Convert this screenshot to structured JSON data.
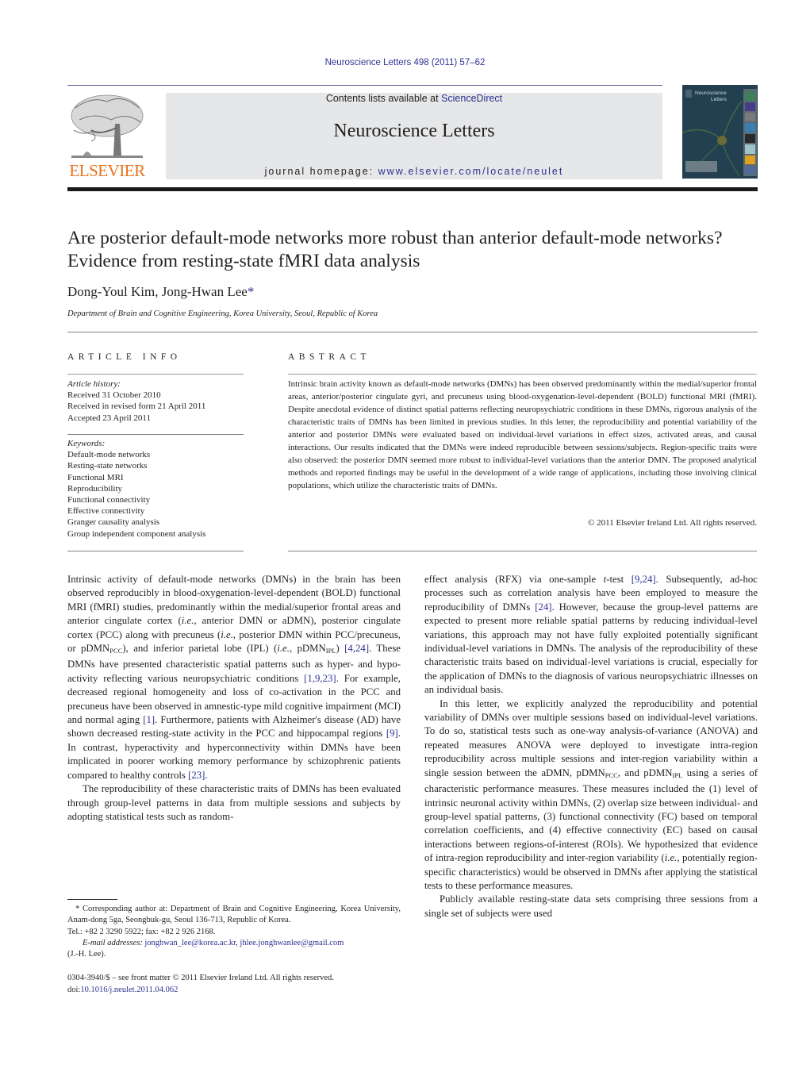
{
  "header": {
    "citation": "Neuroscience Letters 498 (2011) 57–62",
    "contents_prefix": "Contents lists available at ",
    "contents_link": "ScienceDirect",
    "journal_title": "Neuroscience Letters",
    "homepage_prefix": "journal homepage: ",
    "homepage_link": "www.elsevier.com/locate/neulet",
    "publisher_logo_text": "ELSEVIER",
    "cover": {
      "title_line1": "Neuroscience",
      "title_line2": "Letters"
    }
  },
  "colors": {
    "link": "#2e3192",
    "publisher_orange": "#e9711c",
    "banner_bg": "#e6e7e8",
    "text": "#231f20"
  },
  "article": {
    "title": "Are posterior default-mode networks more robust than anterior default-mode networks? Evidence from resting-state fMRI data analysis",
    "authors": "Dong-Youl Kim, Jong-Hwan Lee",
    "author_mark": "*",
    "affiliation": "Department of Brain and Cognitive Engineering, Korea University, Seoul, Republic of Korea"
  },
  "article_info": {
    "heading": "ARTICLE INFO",
    "history_label": "Article history:",
    "history": [
      "Received 31 October 2010",
      "Received in revised form 21 April 2011",
      "Accepted 23 April 2011"
    ],
    "keywords_label": "Keywords:",
    "keywords": [
      "Default-mode networks",
      "Resting-state networks",
      "Functional MRI",
      "Reproducibility",
      "Functional connectivity",
      "Effective connectivity",
      "Granger causality analysis",
      "Group independent component analysis"
    ]
  },
  "abstract": {
    "heading": "ABSTRACT",
    "text": "Intrinsic brain activity known as default-mode networks (DMNs) has been observed predominantly within the medial/superior frontal areas, anterior/posterior cingulate gyri, and precuneus using blood-oxygenation-level-dependent (BOLD) functional MRI (fMRI). Despite anecdotal evidence of distinct spatial patterns reflecting neuropsychiatric conditions in these DMNs, rigorous analysis of the characteristic traits of DMNs has been limited in previous studies. In this letter, the reproducibility and potential variability of the anterior and posterior DMNs were evaluated based on individual-level variations in effect sizes, activated areas, and causal interactions. Our results indicated that the DMNs were indeed reproducible between sessions/subjects. Region-specific traits were also observed: the posterior DMN seemed more robust to individual-level variations than the anterior DMN. The proposed analytical methods and reported findings may be useful in the development of a wide range of applications, including those involving clinical populations, which utilize the characteristic traits of DMNs.",
    "copyright": "© 2011 Elsevier Ireland Ltd. All rights reserved."
  },
  "body": {
    "col1_p1": [
      "Intrinsic activity of default-mode networks (DMNs) in the brain has been observed reproducibly in blood-oxygenation-level-dependent (BOLD) functional MRI (fMRI) studies, predominantly within the medial/superior frontal areas and anterior cingulate cortex (",
      "i.e.",
      ", anterior DMN or aDMN), posterior cingulate cortex (PCC) along with precuneus (",
      "i.e.",
      ", posterior DMN within PCC/precuneus, or pDMN",
      "PCC",
      "), and inferior parietal lobe (IPL) (",
      "i.e.",
      ", pDMN",
      "IPL",
      ") ",
      "[4,24]",
      ". These DMNs have presented characteristic spatial patterns such as hyper- and hypo-activity reflecting various neuropsychiatric conditions ",
      "[1,9,23]",
      ". For example, decreased regional homogeneity and loss of co-activation in the PCC and precuneus have been observed in amnestic-type mild cognitive impairment (MCI) and normal aging ",
      "[1]",
      ". Furthermore, patients with Alzheimer's disease (AD) have shown decreased resting-state activity in the PCC and hippocampal regions ",
      "[9]",
      ". In contrast, hyperactivity and hyperconnectivity within DMNs have been implicated in poorer working memory performance by schizophrenic patients compared to healthy controls ",
      "[23]",
      "."
    ],
    "col1_p2": "The reproducibility of these characteristic traits of DMNs has been evaluated through group-level patterns in data from multiple sessions and subjects by adopting statistical tests such as random-",
    "col2_p1": [
      "effect analysis (RFX) via one-sample ",
      "t",
      "-test ",
      "[9,24]",
      ". Subsequently, ad-hoc processes such as correlation analysis have been employed to measure the reproducibility of DMNs ",
      "[24]",
      ". However, because the group-level patterns are expected to present more reliable spatial patterns by reducing individual-level variations, this approach may not have fully exploited potentially significant individual-level variations in DMNs. The analysis of the reproducibility of these characteristic traits based on individual-level variations is crucial, especially for the application of DMNs to the diagnosis of various neuropsychiatric illnesses on an individual basis."
    ],
    "col2_p2": [
      "In this letter, we explicitly analyzed the reproducibility and potential variability of DMNs over multiple sessions based on individual-level variations. To do so, statistical tests such as one-way analysis-of-variance (ANOVA) and repeated measures ANOVA were deployed to investigate intra-region reproducibility across multiple sessions and inter-region variability within a single session between the aDMN, pDMN",
      "PCC",
      ", and pDMN",
      "IPL",
      " using a series of characteristic performance measures. These measures included the (1) level of intrinsic neuronal activity within DMNs, (2) overlap size between individual- and group-level spatial patterns, (3) functional connectivity (FC) based on temporal correlation coefficients, and (4) effective connectivity (EC) based on causal interactions between regions-of-interest (ROIs). We hypothesized that evidence of intra-region reproducibility and inter-region variability (",
      "i.e.",
      ", potentially region-specific characteristics) would be observed in DMNs after applying the statistical tests to these performance measures."
    ],
    "col2_p3": "Publicly available resting-state data sets comprising three sessions from a single set of subjects were used"
  },
  "footnote": {
    "corresponding": "* Corresponding author at: Department of Brain and Cognitive Engineering, Korea University, Anam-dong 5ga, Seongbuk-gu, Seoul 136-713, Republic of Korea.",
    "tel": "Tel.: +82 2 3290 5922; fax: +82 2 926 2168.",
    "email_label": "E-mail addresses:",
    "email1": "jonghwan_lee@korea.ac.kr",
    "email2": "jhlee.jonghwanlee@gmail.com",
    "email_suffix": "(J.-H. Lee).",
    "frontmatter": "0304-3940/$ – see front matter © 2011 Elsevier Ireland Ltd. All rights reserved.",
    "doi_prefix": "doi:",
    "doi_link": "10.1016/j.neulet.2011.04.062"
  }
}
